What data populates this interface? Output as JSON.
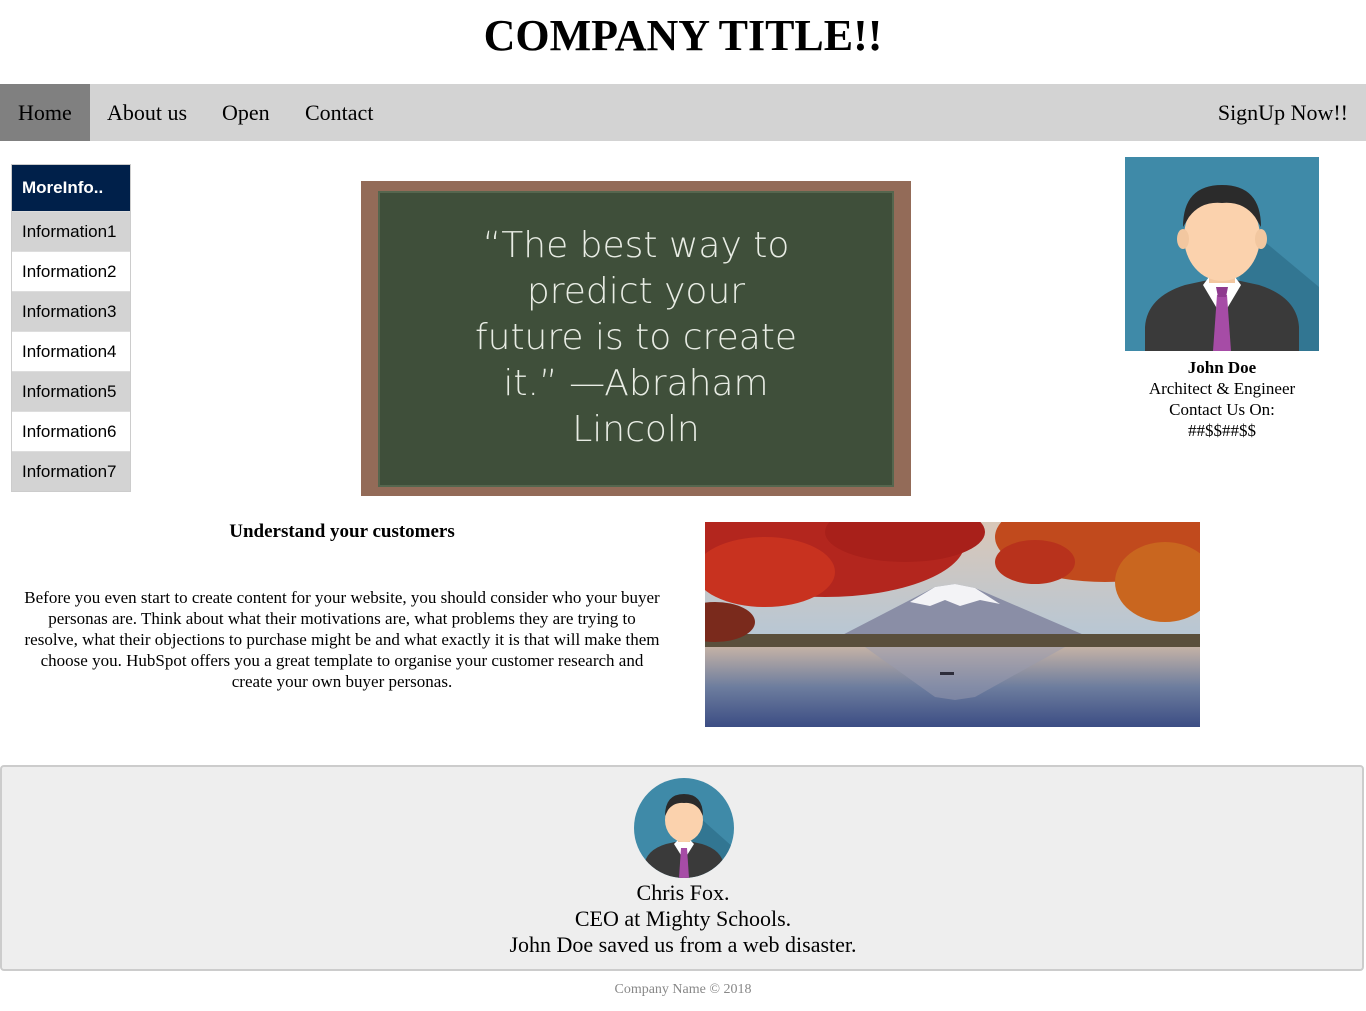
{
  "header": {
    "title": "COMPANY TITLE!!"
  },
  "nav": {
    "items": [
      "Home",
      "About us",
      "Open",
      "Contact"
    ],
    "signup": "SignUp Now!!",
    "bg_color": "#d3d3d3",
    "active_color": "#808080"
  },
  "sidebar": {
    "heading": "MoreInfo..",
    "heading_color": "#00204a",
    "items": [
      "Information1",
      "Information2",
      "Information3",
      "Information4",
      "Information5",
      "Information6",
      "Information7"
    ]
  },
  "quote": {
    "lines": [
      "“The best way to",
      "predict your",
      "future is to create",
      "it.” —Abraham",
      "Lincoln"
    ]
  },
  "profile": {
    "name": "John Doe",
    "role": "Architect & Engineer",
    "contact_label": "Contact Us On:",
    "contact_value": "##$$##$$"
  },
  "article": {
    "title": "Understand your customers",
    "body": "Before you even start to create content for your website, you should consider who your buyer personas are. Think about what their motivations are, what problems they are trying to resolve, what their objections to purchase might be and what exactly it is that will make them choose you. HubSpot offers you a great template to organise your customer research and create your own buyer personas."
  },
  "testimonial": {
    "name": "Chris Fox.",
    "title": "CEO at Mighty Schools.",
    "quote": "John Doe saved us from a web disaster."
  },
  "footer": {
    "text": "Company Name © 2018"
  }
}
